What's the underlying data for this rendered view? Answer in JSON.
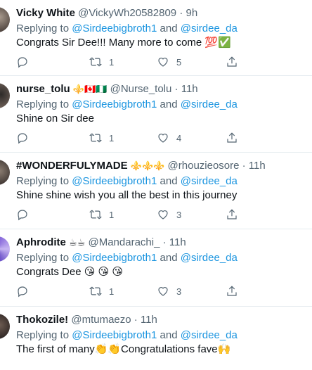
{
  "tweets": [
    {
      "name": "Vicky White",
      "name_emojis": "",
      "handle": "@VickyWh20582809",
      "time": "9h",
      "replying_prefix": "Replying to ",
      "mention1": "@Sirdeebigbroth1",
      "and_text": " and ",
      "mention2": "@sirdee_da",
      "text": "Congrats Sir Dee!!!  Many more to come 💯✅",
      "reply_count": "",
      "retweet_count": "1",
      "like_count": "5"
    },
    {
      "name": "nurse_tolu",
      "name_emojis": "⚜️🇨🇦🇳🇬",
      "handle": "@Nurse_tolu",
      "time": "11h",
      "replying_prefix": "Replying to ",
      "mention1": "@Sirdeebigbroth1",
      "and_text": " and ",
      "mention2": "@sirdee_da",
      "text": "Shine on Sir dee",
      "reply_count": "",
      "retweet_count": "1",
      "like_count": "4"
    },
    {
      "name": "#WONDERFULYMADE",
      "name_emojis": "⚜️⚜️⚜️",
      "handle": "@rhouzieosore",
      "time": "11h",
      "replying_prefix": "Replying to ",
      "mention1": "@Sirdeebigbroth1",
      "and_text": " and ",
      "mention2": "@sirdee_da",
      "text": "Shine shine wish you all the best in this journey",
      "reply_count": "",
      "retweet_count": "1",
      "like_count": "3"
    },
    {
      "name": "Aphrodite",
      "name_emojis": "☕☕",
      "handle": "@Mandarachi_",
      "time": "11h",
      "replying_prefix": "Replying to ",
      "mention1": "@Sirdeebigbroth1",
      "and_text": " and ",
      "mention2": "@sirdee_da",
      "text": "Congrats Dee 😘 😘 😘",
      "reply_count": "",
      "retweet_count": "1",
      "like_count": "3"
    },
    {
      "name": "Thokozile!",
      "name_emojis": "",
      "handle": "@mtumaezo",
      "time": "11h",
      "replying_prefix": "Replying to ",
      "mention1": "@Sirdeebigbroth1",
      "and_text": " and ",
      "mention2": "@sirdee_da",
      "text": "The first of many👏👏Congratulations fave🙌",
      "reply_count": "",
      "retweet_count": "",
      "like_count": ""
    }
  ],
  "dot": "·",
  "icons": {
    "reply": "reply-icon",
    "retweet": "retweet-icon",
    "like": "heart-icon",
    "share": "share-icon"
  },
  "colors": {
    "link": "#1b95e0",
    "muted": "#536471",
    "text": "#0f1419",
    "divider": "#e6ecf0"
  }
}
